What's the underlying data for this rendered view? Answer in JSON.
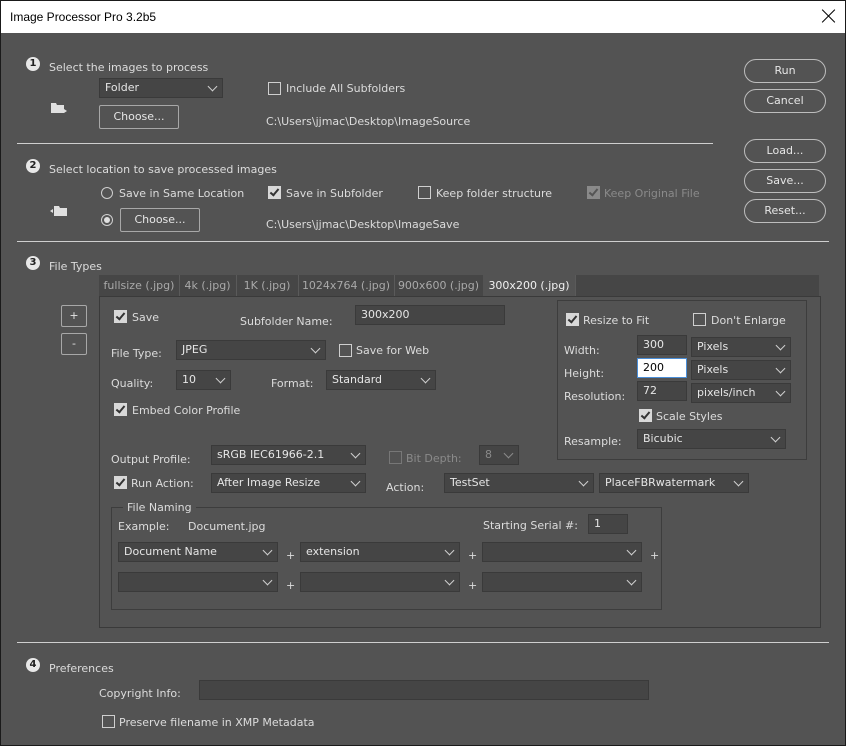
{
  "window": {
    "title": "Image Processor Pro 3.2b5"
  },
  "section1": {
    "number": "1",
    "heading": "Select the images to process",
    "source_dropdown": "Folder",
    "include_subfolders_label": "Include All Subfolders",
    "choose_label": "Choose...",
    "source_path": "C:\\Users\\jjmac\\Desktop\\ImageSource"
  },
  "section2": {
    "number": "2",
    "heading": "Select location to save processed images",
    "same_location_label": "Save in Same Location",
    "subfolder_label": "Save in Subfolder",
    "keep_structure_label": "Keep folder structure",
    "keep_original_label": "Keep Original File",
    "choose_label": "Choose...",
    "dest_path": "C:\\Users\\jjmac\\Desktop\\ImageSave"
  },
  "side_buttons": {
    "run": "Run",
    "cancel": "Cancel",
    "load": "Load...",
    "save": "Save...",
    "reset": "Reset..."
  },
  "section3": {
    "number": "3",
    "heading": "File Types",
    "add": "+",
    "remove": "-",
    "tabs": [
      "fullsize (.jpg)",
      "4k (.jpg)",
      "1K (.jpg)",
      "1024x764 (.jpg)",
      "900x600 (.jpg)",
      "300x200 (.jpg)"
    ],
    "save_label": "Save",
    "subfolder_name_label": "Subfolder Name:",
    "subfolder_name_value": "300x200",
    "file_type_label": "File Type:",
    "file_type_value": "JPEG",
    "save_for_web_label": "Save for Web",
    "quality_label": "Quality:",
    "quality_value": "10",
    "format_label": "Format:",
    "format_value": "Standard",
    "embed_profile_label": "Embed Color Profile",
    "output_profile_label": "Output Profile:",
    "output_profile_value": "sRGB IEC61966-2.1",
    "bit_depth_label": "Bit Depth:",
    "bit_depth_value": "8",
    "run_action_label": "Run Action:",
    "run_action_value": "After Image Resize",
    "action_label": "Action:",
    "action_set": "TestSet",
    "action_name": "PlaceFBRwatermark",
    "resize": {
      "resize_to_fit_label": "Resize to Fit",
      "dont_enlarge_label": "Don't Enlarge",
      "width_label": "Width:",
      "width_value": "300",
      "width_unit": "Pixels",
      "height_label": "Height:",
      "height_value": "200",
      "height_unit": "Pixels",
      "resolution_label": "Resolution:",
      "resolution_value": "72",
      "resolution_unit": "pixels/inch",
      "scale_styles_label": "Scale Styles",
      "resample_label": "Resample:",
      "resample_value": "Bicubic"
    },
    "naming": {
      "group_label": "File Naming",
      "example_label": "Example:",
      "example_value": "Document.jpg",
      "serial_label": "Starting Serial #:",
      "serial_value": "1",
      "row1": [
        "Document Name",
        "extension",
        ""
      ],
      "row2": [
        "",
        "",
        ""
      ],
      "plus": "+"
    }
  },
  "section4": {
    "number": "4",
    "heading": "Preferences",
    "copyright_label": "Copyright Info:",
    "copyright_value": "",
    "preserve_label": "Preserve filename in XMP Metadata"
  }
}
